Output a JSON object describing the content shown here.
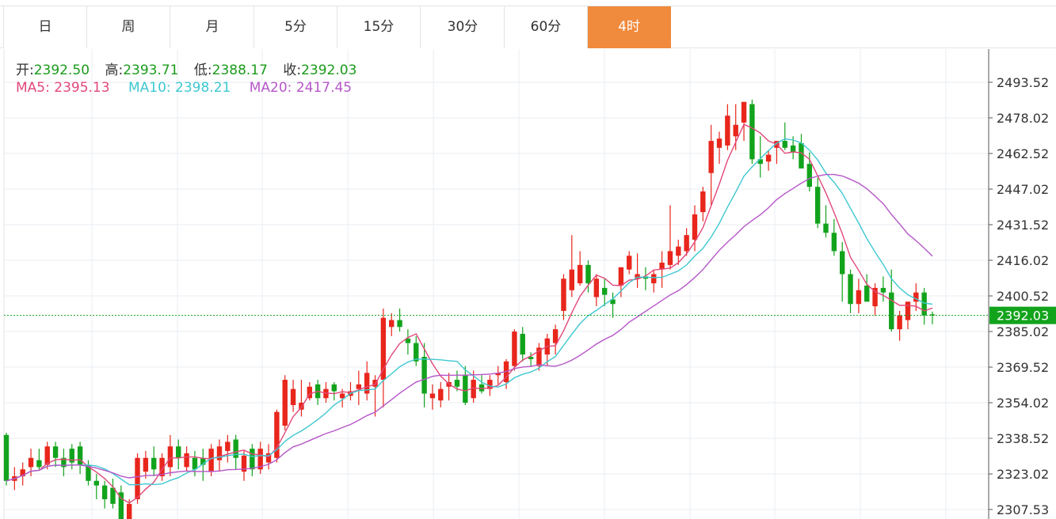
{
  "tabs": [
    {
      "label": "日",
      "active": false
    },
    {
      "label": "周",
      "active": false
    },
    {
      "label": "月",
      "active": false
    },
    {
      "label": "5分",
      "active": false
    },
    {
      "label": "15分",
      "active": false
    },
    {
      "label": "30分",
      "active": false
    },
    {
      "label": "60分",
      "active": false
    },
    {
      "label": "4时",
      "active": true
    }
  ],
  "ohlc": {
    "open_label": "开:",
    "open": "2392.50",
    "high_label": "高:",
    "high": "2393.71",
    "low_label": "低:",
    "low": "2388.17",
    "close_label": "收:",
    "close": "2392.03"
  },
  "ma": {
    "ma5_label": "MA5:",
    "ma5": "2395.13",
    "ma10_label": "MA10:",
    "ma10": "2398.21",
    "ma20_label": "MA20:",
    "ma20": "2417.45"
  },
  "colors": {
    "up": "#e8261c",
    "down": "#12a31c",
    "ma5": "#e2487a",
    "ma10": "#3ec8d0",
    "ma20": "#b656c8",
    "last_price": "#12a31c",
    "active_tab": "#f08a3c"
  },
  "chart_data": {
    "type": "candlestick",
    "y_axis_ticks": [
      "2493.52",
      "2478.02",
      "2462.52",
      "2447.02",
      "2431.52",
      "2416.02",
      "2400.52",
      "2385.02",
      "2369.52",
      "2354.02",
      "2338.52",
      "2323.02",
      "2307.53"
    ],
    "ylim": [
      2304,
      2502
    ],
    "grid": true,
    "last_price": "2392.03",
    "candles": [
      [
        2340,
        2341,
        2318,
        2320
      ],
      [
        2320,
        2326,
        2316,
        2322
      ],
      [
        2322,
        2328,
        2318,
        2325
      ],
      [
        2326,
        2334,
        2322,
        2330
      ],
      [
        2329,
        2334,
        2325,
        2326
      ],
      [
        2327,
        2337,
        2325,
        2335
      ],
      [
        2335,
        2337,
        2326,
        2330
      ],
      [
        2330,
        2334,
        2322,
        2326
      ],
      [
        2334,
        2336,
        2325,
        2328
      ],
      [
        2335,
        2337,
        2323,
        2327
      ],
      [
        2327,
        2329,
        2318,
        2320
      ],
      [
        2320,
        2323,
        2312,
        2318
      ],
      [
        2318,
        2320,
        2308,
        2312
      ],
      [
        2317,
        2321,
        2308,
        2310
      ],
      [
        2315,
        2318,
        2300,
        2302
      ],
      [
        2301,
        2312,
        2299,
        2310
      ],
      [
        2312,
        2332,
        2310,
        2330
      ],
      [
        2324,
        2333,
        2321,
        2330
      ],
      [
        2330,
        2335,
        2322,
        2325
      ],
      [
        2322,
        2332,
        2320,
        2330
      ],
      [
        2326,
        2340,
        2322,
        2335
      ],
      [
        2335,
        2338,
        2325,
        2330
      ],
      [
        2326,
        2335,
        2324,
        2332
      ],
      [
        2330,
        2333,
        2322,
        2325
      ],
      [
        2330,
        2334,
        2320,
        2327
      ],
      [
        2324,
        2336,
        2322,
        2334
      ],
      [
        2329,
        2338,
        2324,
        2335
      ],
      [
        2333,
        2340,
        2328,
        2337
      ],
      [
        2338,
        2340,
        2325,
        2330
      ],
      [
        2324,
        2333,
        2320,
        2331
      ],
      [
        2334,
        2336,
        2322,
        2325
      ],
      [
        2325,
        2337,
        2323,
        2334
      ],
      [
        2328,
        2336,
        2325,
        2332
      ],
      [
        2330,
        2351,
        2328,
        2350
      ],
      [
        2344,
        2366,
        2342,
        2364
      ],
      [
        2353,
        2364,
        2350,
        2360
      ],
      [
        2351,
        2364,
        2348,
        2354
      ],
      [
        2356,
        2363,
        2355,
        2361
      ],
      [
        2362,
        2364,
        2353,
        2356
      ],
      [
        2356,
        2363,
        2354,
        2360
      ],
      [
        2362,
        2363,
        2355,
        2359
      ],
      [
        2356,
        2360,
        2352,
        2358
      ],
      [
        2357,
        2363,
        2355,
        2359
      ],
      [
        2360,
        2368,
        2353,
        2362
      ],
      [
        2358,
        2372,
        2355,
        2367
      ],
      [
        2361,
        2366,
        2348,
        2364
      ],
      [
        2364,
        2395,
        2352,
        2391
      ],
      [
        2387,
        2393,
        2383,
        2390
      ],
      [
        2390,
        2395,
        2385,
        2387
      ],
      [
        2382,
        2386,
        2375,
        2380
      ],
      [
        2380,
        2383,
        2370,
        2372
      ],
      [
        2374,
        2380,
        2352,
        2358
      ],
      [
        2356,
        2362,
        2351,
        2358
      ],
      [
        2355,
        2363,
        2352,
        2360
      ],
      [
        2361,
        2367,
        2355,
        2363
      ],
      [
        2364,
        2368,
        2359,
        2361
      ],
      [
        2366,
        2370,
        2353,
        2354
      ],
      [
        2356,
        2368,
        2354,
        2364
      ],
      [
        2362,
        2366,
        2358,
        2359
      ],
      [
        2360,
        2366,
        2357,
        2364
      ],
      [
        2366,
        2370,
        2362,
        2367
      ],
      [
        2363,
        2373,
        2360,
        2372
      ],
      [
        2370,
        2386,
        2368,
        2385
      ],
      [
        2384,
        2387,
        2372,
        2375
      ],
      [
        2374,
        2376,
        2370,
        2373
      ],
      [
        2370,
        2380,
        2368,
        2378
      ],
      [
        2375,
        2384,
        2370,
        2382
      ],
      [
        2380,
        2388,
        2375,
        2386
      ],
      [
        2394,
        2410,
        2390,
        2408
      ],
      [
        2403,
        2427,
        2400,
        2412
      ],
      [
        2406,
        2420,
        2405,
        2414
      ],
      [
        2414,
        2416,
        2402,
        2406
      ],
      [
        2400,
        2410,
        2396,
        2408
      ],
      [
        2404,
        2408,
        2396,
        2401
      ],
      [
        2399,
        2402,
        2391,
        2397
      ],
      [
        2405,
        2412,
        2400,
        2413
      ],
      [
        2412,
        2420,
        2410,
        2418
      ],
      [
        2408,
        2419,
        2404,
        2410
      ],
      [
        2409,
        2413,
        2403,
        2408
      ],
      [
        2406,
        2412,
        2402,
        2410
      ],
      [
        2412,
        2420,
        2404,
        2415
      ],
      [
        2414,
        2440,
        2412,
        2420
      ],
      [
        2418,
        2425,
        2414,
        2422
      ],
      [
        2420,
        2430,
        2418,
        2427
      ],
      [
        2425,
        2440,
        2420,
        2436
      ],
      [
        2437,
        2448,
        2433,
        2446
      ],
      [
        2454,
        2475,
        2440,
        2468
      ],
      [
        2465,
        2472,
        2458,
        2469
      ],
      [
        2466,
        2484,
        2464,
        2479
      ],
      [
        2470,
        2484,
        2464,
        2475
      ],
      [
        2476,
        2484,
        2468,
        2485
      ],
      [
        2484,
        2486,
        2458,
        2460
      ],
      [
        2460,
        2470,
        2452,
        2458
      ],
      [
        2459,
        2464,
        2455,
        2462
      ],
      [
        2465,
        2468,
        2458,
        2468
      ],
      [
        2468,
        2476,
        2464,
        2465
      ],
      [
        2466,
        2470,
        2460,
        2463
      ],
      [
        2467,
        2471,
        2462,
        2456
      ],
      [
        2458,
        2463,
        2446,
        2448
      ],
      [
        2448,
        2452,
        2430,
        2432
      ],
      [
        2432,
        2440,
        2426,
        2428
      ],
      [
        2428,
        2434,
        2418,
        2420
      ],
      [
        2420,
        2424,
        2398,
        2410
      ],
      [
        2410,
        2412,
        2393,
        2397
      ],
      [
        2397,
        2408,
        2393,
        2403
      ],
      [
        2405,
        2410,
        2398,
        2398
      ],
      [
        2396,
        2406,
        2392,
        2404
      ],
      [
        2404,
        2409,
        2398,
        2402
      ],
      [
        2402,
        2412,
        2385,
        2386
      ],
      [
        2386,
        2394,
        2381,
        2392
      ],
      [
        2390,
        2398,
        2386,
        2398
      ],
      [
        2398,
        2406,
        2394,
        2402
      ],
      [
        2402,
        2404,
        2388,
        2392
      ],
      [
        2392.5,
        2393.71,
        2388.17,
        2392.03
      ]
    ]
  }
}
